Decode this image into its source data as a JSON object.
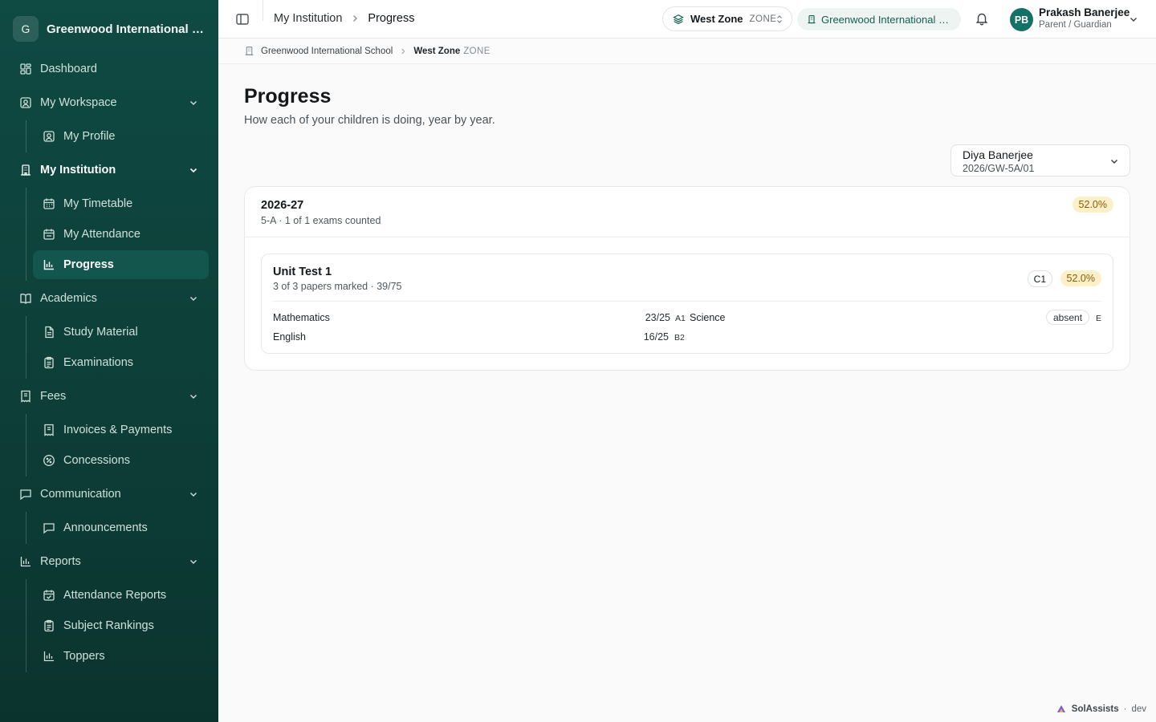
{
  "org": {
    "initial": "G",
    "name": "Greenwood International School"
  },
  "sidebar": {
    "dashboard": "Dashboard",
    "sections": [
      {
        "label": "My Workspace",
        "items": [
          "My Profile"
        ]
      },
      {
        "label": "My Institution",
        "items": [
          "My Timetable",
          "My Attendance",
          "Progress"
        ]
      },
      {
        "label": "Academics",
        "items": [
          "Study Material",
          "Examinations"
        ]
      },
      {
        "label": "Fees",
        "items": [
          "Invoices & Payments",
          "Concessions"
        ]
      },
      {
        "label": "Communication",
        "items": [
          "Announcements"
        ]
      },
      {
        "label": "Reports",
        "items": [
          "Attendance Reports",
          "Subject Rankings",
          "Toppers"
        ]
      }
    ]
  },
  "header": {
    "crumb_parent": "My Institution",
    "crumb_current": "Progress",
    "zone_name": "West Zone",
    "zone_tag": "ZONE",
    "school_name": "Greenwood International School",
    "user_initials": "PB",
    "user_name": "Prakash Banerjee",
    "user_role": "Parent / Guardian"
  },
  "subcrumb": {
    "school": "Greenwood International School",
    "zone": "West Zone",
    "zone_tag": "ZONE"
  },
  "page": {
    "title": "Progress",
    "subtitle": "How each of your children is doing, year by year."
  },
  "child_select": {
    "name": "Diya Banerjee",
    "id": "2026/GW-5A/01"
  },
  "year": {
    "label": "2026-27",
    "meta": "5-A · 1 of 1 exams counted",
    "percent": "52.0%",
    "exam": {
      "name": "Unit Test 1",
      "meta": "3 of 3 papers marked · 39/75",
      "grade": "C1",
      "percent": "52.0%",
      "subjects": [
        {
          "name": "Mathematics",
          "score": "23/25",
          "grade": "A1"
        },
        {
          "name": "Science",
          "status": "absent",
          "grade": "E"
        },
        {
          "name": "English",
          "score": "16/25",
          "grade": "B2"
        }
      ]
    }
  },
  "footer": {
    "brand": "SolAssists",
    "env": "dev"
  }
}
